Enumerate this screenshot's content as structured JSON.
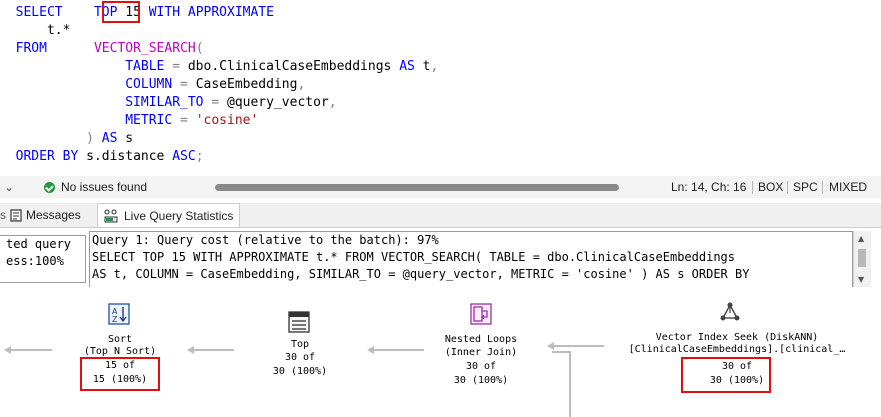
{
  "editor": {
    "line1": {
      "select": "SELECT",
      "top": "TOP",
      "top_value": "15",
      "with_approx": "WITH APPROXIMATE"
    },
    "line2": {
      "cols": "t.*"
    },
    "line3": {
      "from": "FROM",
      "vector_search": "VECTOR_SEARCH",
      "paren": "("
    },
    "line4": {
      "key": "TABLE",
      "eq": " = ",
      "value": "dbo.ClinicalCaseEmbeddings",
      "as": "AS",
      "alias": "t",
      "comma": ","
    },
    "line5": {
      "key": "COLUMN",
      "eq": " = ",
      "value": "CaseEmbedding",
      "comma": ","
    },
    "line6": {
      "key": "SIMILAR_TO",
      "eq": " = ",
      "value": "@query_vector",
      "comma": ","
    },
    "line7": {
      "key": "METRIC",
      "eq": " = ",
      "value": "'cosine'"
    },
    "line8": {
      "paren": ")",
      "as": "AS",
      "alias": "s"
    },
    "line9": {
      "order_by": "ORDER BY",
      "expr": "s.distance",
      "asc": "ASC",
      "semi": ";"
    }
  },
  "status_bar": {
    "issues": "No issues found",
    "position": "Ln: 14, Ch: 16",
    "box": "BOX",
    "spc": "SPC",
    "mixed": "MIXED"
  },
  "tabs": {
    "messages": "Messages",
    "live_query_statistics": "Live Query Statistics"
  },
  "cost_panel": {
    "left_line1": "ted query",
    "left_line2": "ess:100%",
    "query_lines": [
      "Query 1: Query cost (relative to the batch): 97%",
      "SELECT TOP 15 WITH APPROXIMATE t.* FROM VECTOR_SEARCH( TABLE = dbo.ClinicalCaseEmbeddings",
      "AS t, COLUMN = CaseEmbedding, SIMILAR_TO = @query_vector, METRIC = 'cosine' ) AS s ORDER BY"
    ]
  },
  "plan": {
    "sort": {
      "name": "Sort",
      "detail": "(Top N Sort)",
      "rows": "15 of",
      "pct": "15 (100%)"
    },
    "top": {
      "name": "Top",
      "rows": "30 of",
      "pct": "30 (100%)"
    },
    "nested_loops": {
      "name": "Nested Loops",
      "detail": "(Inner Join)",
      "rows": "30 of",
      "pct": "30 (100%)"
    },
    "vector_seek": {
      "name": "Vector Index Seek (DiskANN)",
      "detail": "[ClinicalCaseEmbeddings].[clinical_…",
      "rows": "30 of",
      "pct": "30 (100%)"
    }
  },
  "colors": {
    "keyword": "#0000ff",
    "function": "#c000c0",
    "string": "#a31515",
    "highlight": "#e01010",
    "ok": "#1f9d3a"
  }
}
